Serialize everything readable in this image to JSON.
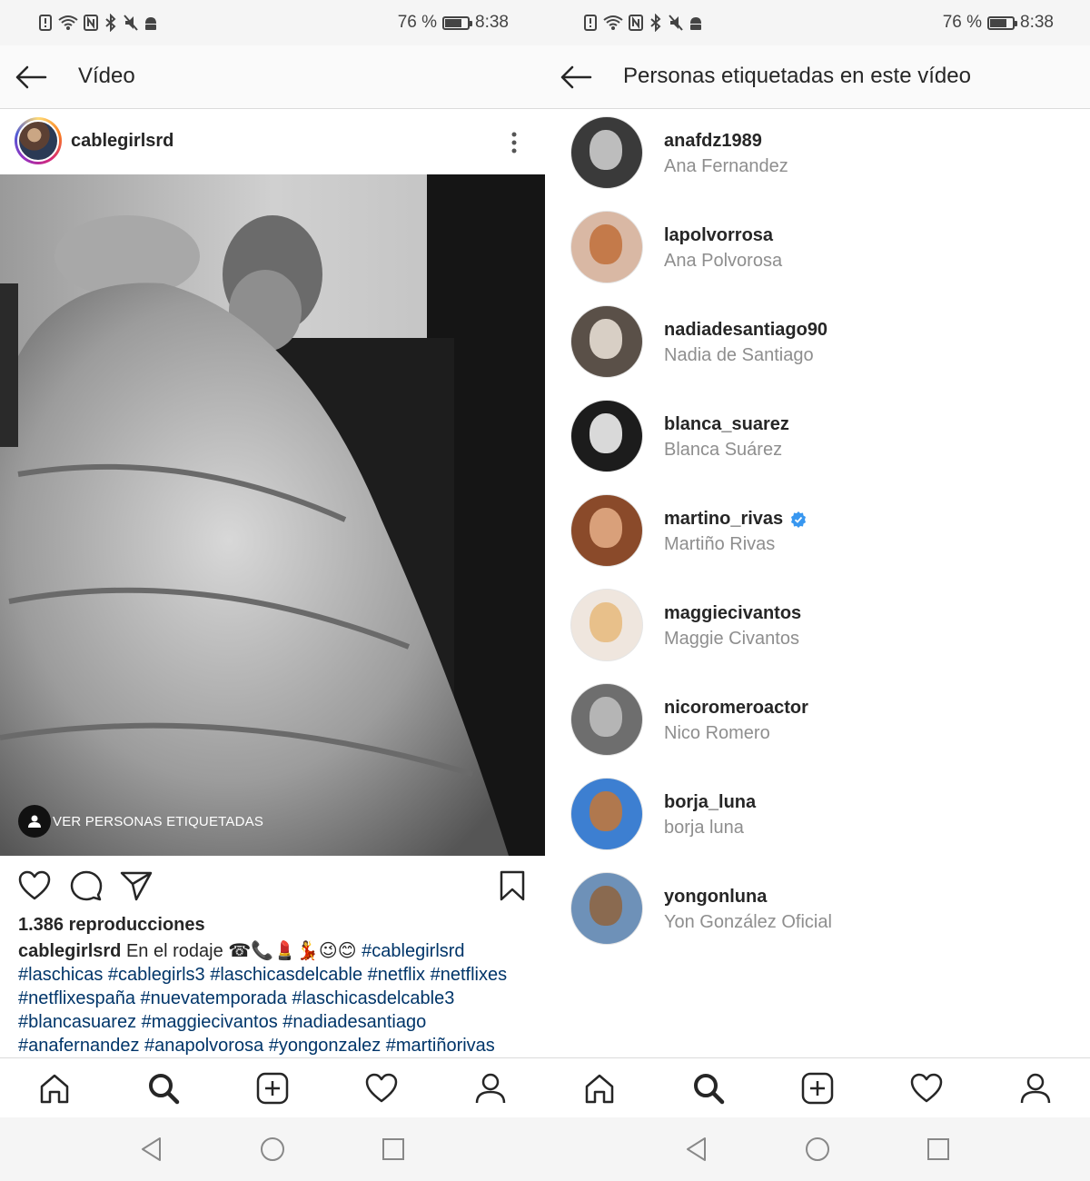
{
  "status": {
    "battery_text": "76 %",
    "battery_level": 0.76,
    "time": "8:38",
    "icons": [
      "sim-alert-icon",
      "wifi-icon",
      "nfc-icon",
      "bluetooth-icon",
      "mute-icon",
      "android-icon"
    ]
  },
  "left": {
    "header": {
      "title": "Vídeo"
    },
    "post": {
      "username": "cablegirlsrd",
      "tag_button_label": "VER PERSONAS ETIQUETADAS",
      "views": "1.386 reproducciones",
      "caption": {
        "user": "cablegirlsrd",
        "text": "En el rodaje",
        "emojis": "☎📞💄💃😉😊",
        "hashtags_line1": "#cablegirlsrd",
        "hashtags_line2": "#laschicas #cablegirls3 #laschicasdelcable #netflix #netflixes",
        "hashtags_line3": "#netflixespaña #nuevatemporada #laschicasdelcable3",
        "hashtags_line4": "#blancasuarez #maggiecivantos #nadiadesantiago",
        "hashtags_line5": "#anafernandez #anapolvorosa #yongonzalez #martiñorivas"
      }
    }
  },
  "right": {
    "header": {
      "title": "Personas etiquetadas en este vídeo"
    },
    "people": [
      {
        "username": "anafdz1989",
        "full_name": "Ana Fernandez",
        "verified": false,
        "bg": "#3a3a3a",
        "face": "#bdbdbd"
      },
      {
        "username": "lapolvorrosa",
        "full_name": "Ana Polvorosa",
        "verified": false,
        "bg": "#d9b8a4",
        "face": "#c47a4a"
      },
      {
        "username": "nadiadesantiago90",
        "full_name": "Nadia de Santiago",
        "verified": false,
        "bg": "#5a5048",
        "face": "#d8cfc5"
      },
      {
        "username": "blanca_suarez",
        "full_name": "Blanca Suárez",
        "verified": false,
        "bg": "#1c1c1c",
        "face": "#d9d9d9"
      },
      {
        "username": "martino_rivas",
        "full_name": "Martiño Rivas",
        "verified": true,
        "bg": "#8a4a2a",
        "face": "#d9a07a"
      },
      {
        "username": "maggiecivantos",
        "full_name": "Maggie Civantos",
        "verified": false,
        "bg": "#efe6de",
        "face": "#e8c08a"
      },
      {
        "username": "nicoromeroactor",
        "full_name": "Nico Romero",
        "verified": false,
        "bg": "#6e6e6e",
        "face": "#b5b5b5"
      },
      {
        "username": "borja_luna",
        "full_name": "borja luna",
        "verified": false,
        "bg": "#3d7fd1",
        "face": "#b0784e"
      },
      {
        "username": "yongonluna",
        "full_name": "Yon González Oficial",
        "verified": false,
        "bg": "#6e91b8",
        "face": "#8a6a50"
      }
    ]
  },
  "colors": {
    "hashtag": "#003569",
    "muted": "#8e8e8e",
    "verified": "#3897f0"
  }
}
